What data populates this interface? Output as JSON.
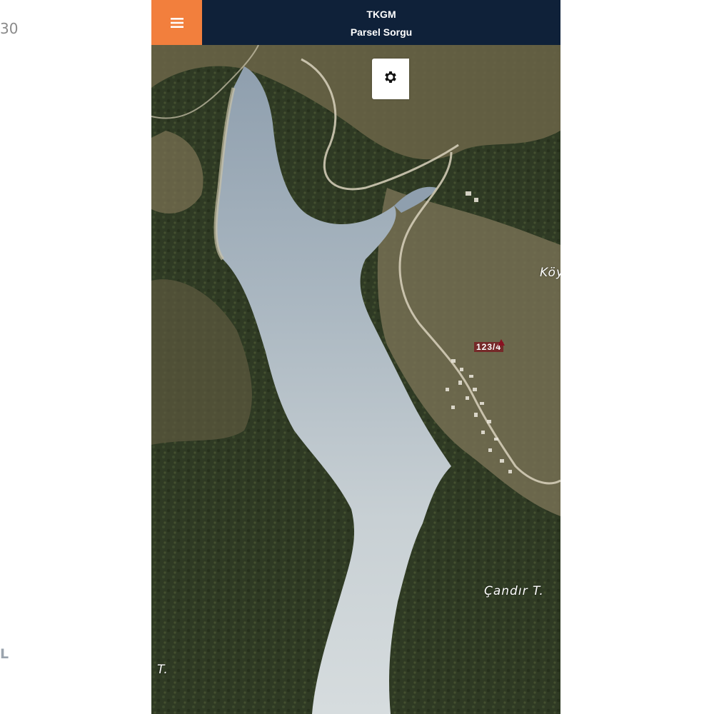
{
  "page": {
    "edge_text": "30",
    "edge_mark": "L"
  },
  "header": {
    "title": "TKGM",
    "subtitle": "Parsel Sorgu",
    "menu_icon": "hamburger-menu-icon",
    "accent_color": "#f27f3d",
    "bar_color": "#0f2139"
  },
  "map_controls": {
    "settings_icon": "gear-icon"
  },
  "map": {
    "type": "satellite",
    "labels": {
      "village": "Köy",
      "hill": "Çandır T.",
      "hill_west": "T.",
      "parcel": "123/4"
    }
  }
}
